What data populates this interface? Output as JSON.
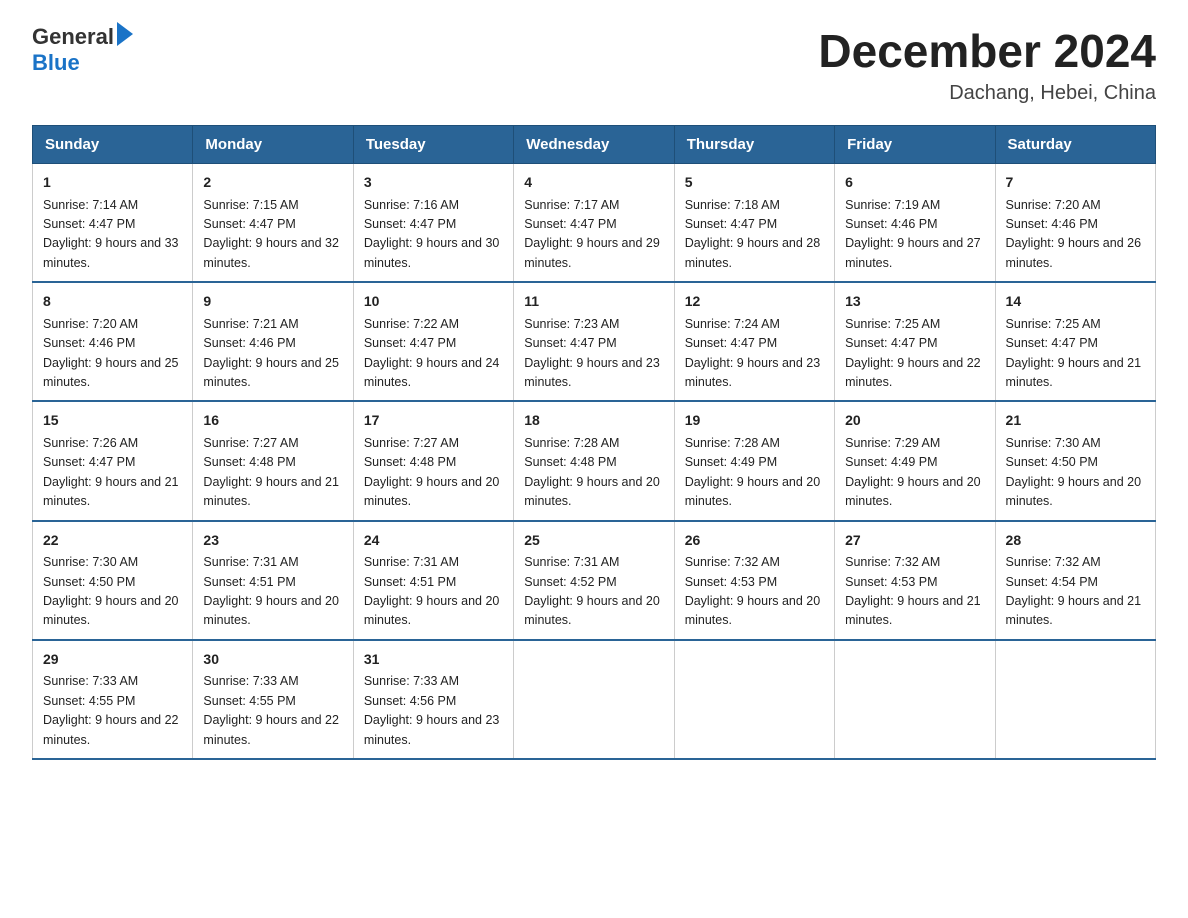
{
  "header": {
    "logo_general": "General",
    "logo_blue": "Blue",
    "main_title": "December 2024",
    "subtitle": "Dachang, Hebei, China"
  },
  "calendar": {
    "days": [
      "Sunday",
      "Monday",
      "Tuesday",
      "Wednesday",
      "Thursday",
      "Friday",
      "Saturday"
    ],
    "weeks": [
      [
        {
          "day": "1",
          "sunrise": "7:14 AM",
          "sunset": "4:47 PM",
          "daylight": "9 hours and 33 minutes."
        },
        {
          "day": "2",
          "sunrise": "7:15 AM",
          "sunset": "4:47 PM",
          "daylight": "9 hours and 32 minutes."
        },
        {
          "day": "3",
          "sunrise": "7:16 AM",
          "sunset": "4:47 PM",
          "daylight": "9 hours and 30 minutes."
        },
        {
          "day": "4",
          "sunrise": "7:17 AM",
          "sunset": "4:47 PM",
          "daylight": "9 hours and 29 minutes."
        },
        {
          "day": "5",
          "sunrise": "7:18 AM",
          "sunset": "4:47 PM",
          "daylight": "9 hours and 28 minutes."
        },
        {
          "day": "6",
          "sunrise": "7:19 AM",
          "sunset": "4:46 PM",
          "daylight": "9 hours and 27 minutes."
        },
        {
          "day": "7",
          "sunrise": "7:20 AM",
          "sunset": "4:46 PM",
          "daylight": "9 hours and 26 minutes."
        }
      ],
      [
        {
          "day": "8",
          "sunrise": "7:20 AM",
          "sunset": "4:46 PM",
          "daylight": "9 hours and 25 minutes."
        },
        {
          "day": "9",
          "sunrise": "7:21 AM",
          "sunset": "4:46 PM",
          "daylight": "9 hours and 25 minutes."
        },
        {
          "day": "10",
          "sunrise": "7:22 AM",
          "sunset": "4:47 PM",
          "daylight": "9 hours and 24 minutes."
        },
        {
          "day": "11",
          "sunrise": "7:23 AM",
          "sunset": "4:47 PM",
          "daylight": "9 hours and 23 minutes."
        },
        {
          "day": "12",
          "sunrise": "7:24 AM",
          "sunset": "4:47 PM",
          "daylight": "9 hours and 23 minutes."
        },
        {
          "day": "13",
          "sunrise": "7:25 AM",
          "sunset": "4:47 PM",
          "daylight": "9 hours and 22 minutes."
        },
        {
          "day": "14",
          "sunrise": "7:25 AM",
          "sunset": "4:47 PM",
          "daylight": "9 hours and 21 minutes."
        }
      ],
      [
        {
          "day": "15",
          "sunrise": "7:26 AM",
          "sunset": "4:47 PM",
          "daylight": "9 hours and 21 minutes."
        },
        {
          "day": "16",
          "sunrise": "7:27 AM",
          "sunset": "4:48 PM",
          "daylight": "9 hours and 21 minutes."
        },
        {
          "day": "17",
          "sunrise": "7:27 AM",
          "sunset": "4:48 PM",
          "daylight": "9 hours and 20 minutes."
        },
        {
          "day": "18",
          "sunrise": "7:28 AM",
          "sunset": "4:48 PM",
          "daylight": "9 hours and 20 minutes."
        },
        {
          "day": "19",
          "sunrise": "7:28 AM",
          "sunset": "4:49 PM",
          "daylight": "9 hours and 20 minutes."
        },
        {
          "day": "20",
          "sunrise": "7:29 AM",
          "sunset": "4:49 PM",
          "daylight": "9 hours and 20 minutes."
        },
        {
          "day": "21",
          "sunrise": "7:30 AM",
          "sunset": "4:50 PM",
          "daylight": "9 hours and 20 minutes."
        }
      ],
      [
        {
          "day": "22",
          "sunrise": "7:30 AM",
          "sunset": "4:50 PM",
          "daylight": "9 hours and 20 minutes."
        },
        {
          "day": "23",
          "sunrise": "7:31 AM",
          "sunset": "4:51 PM",
          "daylight": "9 hours and 20 minutes."
        },
        {
          "day": "24",
          "sunrise": "7:31 AM",
          "sunset": "4:51 PM",
          "daylight": "9 hours and 20 minutes."
        },
        {
          "day": "25",
          "sunrise": "7:31 AM",
          "sunset": "4:52 PM",
          "daylight": "9 hours and 20 minutes."
        },
        {
          "day": "26",
          "sunrise": "7:32 AM",
          "sunset": "4:53 PM",
          "daylight": "9 hours and 20 minutes."
        },
        {
          "day": "27",
          "sunrise": "7:32 AM",
          "sunset": "4:53 PM",
          "daylight": "9 hours and 21 minutes."
        },
        {
          "day": "28",
          "sunrise": "7:32 AM",
          "sunset": "4:54 PM",
          "daylight": "9 hours and 21 minutes."
        }
      ],
      [
        {
          "day": "29",
          "sunrise": "7:33 AM",
          "sunset": "4:55 PM",
          "daylight": "9 hours and 22 minutes."
        },
        {
          "day": "30",
          "sunrise": "7:33 AM",
          "sunset": "4:55 PM",
          "daylight": "9 hours and 22 minutes."
        },
        {
          "day": "31",
          "sunrise": "7:33 AM",
          "sunset": "4:56 PM",
          "daylight": "9 hours and 23 minutes."
        },
        null,
        null,
        null,
        null
      ]
    ]
  }
}
